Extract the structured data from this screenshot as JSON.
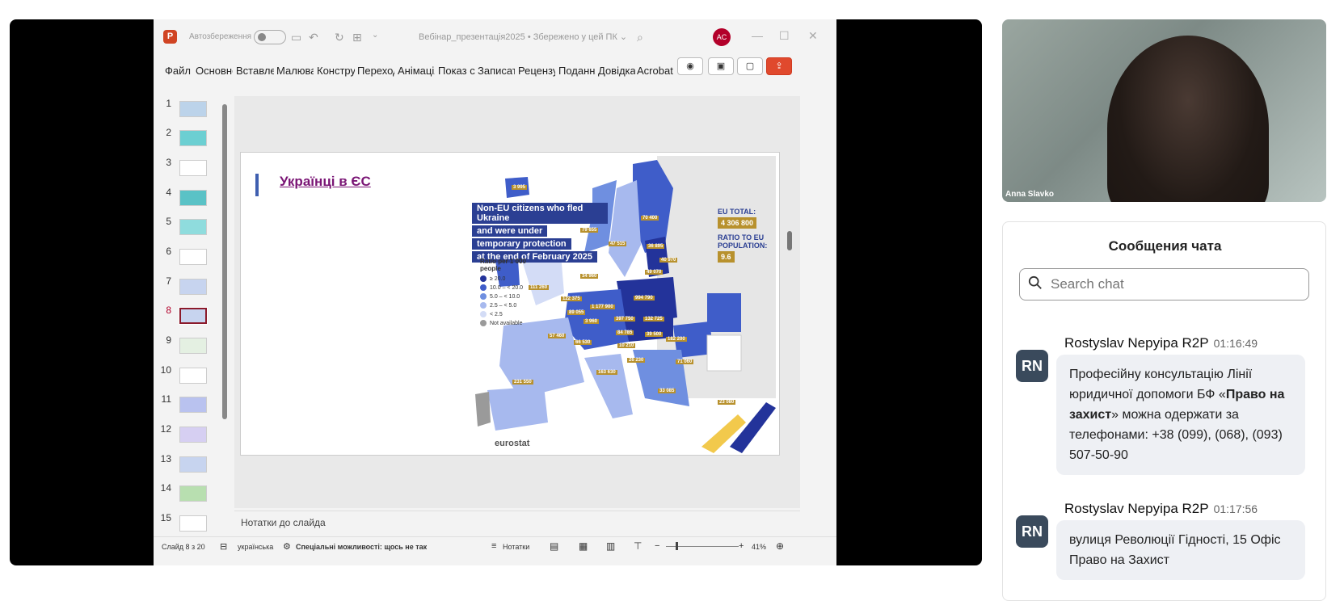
{
  "powerpoint": {
    "app_letter": "P",
    "autosave_label": "Автозбереження",
    "doc_title": "Вебінар_презентація2025 • Збережено у цей ПК ⌄",
    "user_initials": "AC",
    "ribbon_tabs": [
      "Файл",
      "Основне",
      "Вставлення",
      "Малювання",
      "Конструктор",
      "Переходи",
      "Анімація",
      "Показ слайдів",
      "Записати",
      "Рецензування",
      "Подання",
      "Довідка",
      "Acrobat"
    ],
    "slide_numbers": [
      "1",
      "2",
      "3",
      "4",
      "5",
      "6",
      "7",
      "8",
      "9",
      "10",
      "11",
      "12",
      "13",
      "14",
      "15"
    ],
    "active_slide": "8",
    "notes_label": "Нотатки до слайда",
    "status": {
      "slide_of": "Слайд 8 з 20",
      "language": "українська",
      "accessibility": "Спеціальні можливості: щось не так",
      "notes_btn": "Нотатки",
      "zoom": "41%"
    }
  },
  "slide": {
    "title": "Українці в ЄС",
    "banner_lines": [
      "Non-EU citizens who fled Ukraine",
      "and were under",
      "temporary protection",
      "at the end of February 2025"
    ],
    "eu_total_label": "EU TOTAL:",
    "eu_total_value": "4 306 800",
    "ratio_label": "RATIO TO EU POPULATION:",
    "ratio_value": "9.6",
    "legend_title": "Ratio per 1 000 people",
    "legend_items": [
      "≥ 20.0",
      "10.0 – < 20.0",
      "5.0 – < 10.0",
      "2.5 – < 5.0",
      "< 2.5",
      "Not available"
    ],
    "map_labels": [
      "3 995",
      "79 655",
      "47 515",
      "70 400",
      "36 895",
      "40 970",
      "49 070",
      "111 260",
      "34 960",
      "122 375",
      "1 177 900",
      "994 790",
      "89 055",
      "397 750",
      "132 725",
      "3 960",
      "84 785",
      "39 500",
      "57 460",
      "66 530",
      "10 210",
      "182 200",
      "26 230",
      "71 060",
      "163 630",
      "231 550",
      "33 085",
      "23 080"
    ],
    "source": "eurostat"
  },
  "colors": {
    "map_darkest": "#23339a",
    "map_dark": "#3f5dc9",
    "map_mid": "#6f8fe0",
    "map_light": "#a7b9ee",
    "map_lightest": "#d3dcf6",
    "not_available": "#9a9a9a",
    "label_gold": "#b8912d",
    "chat_avatar": "#3a4a5c"
  },
  "video": {
    "participant_name": "Anna Slavko"
  },
  "chat": {
    "title": "Сообщения чата",
    "search_placeholder": "Search chat",
    "messages": [
      {
        "initials": "RN",
        "author": "Rostyslav Nepyipa R2P",
        "time": "01:16:49",
        "text_before": "Професійну консультацію Лінії юридичної допомоги БФ «",
        "text_bold": "Право на захист",
        "text_after": "» можна одержати за телефонами: +38 (099), (068), (093) 507-50-90"
      },
      {
        "initials": "RN",
        "author": "Rostyslav Nepyipa R2P",
        "time": "01:17:56",
        "text": "вулиця Революції Гідності, 15 Офіс Право на Захист"
      }
    ]
  }
}
